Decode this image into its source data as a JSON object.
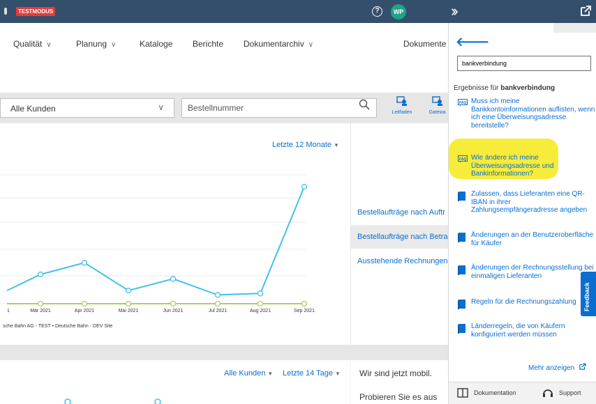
{
  "topbar": {
    "badge": "TESTMODUS",
    "help": "?",
    "avatar": "WP"
  },
  "nav": {
    "items": [
      "Qualität",
      "Planung",
      "Kataloge",
      "Berichte",
      "Dokumentarchiv"
    ],
    "docs": "Dokumente"
  },
  "filters": {
    "customer": "Alle Kunden",
    "order_placeholder": "Bestellnummer",
    "tools": [
      "Leitfaden",
      "Gatewa"
    ]
  },
  "chart": {
    "range": "Letzte 12 Monate",
    "legend": "sche Bahn AG - TEST  •  Deutsche Bahn - DEV Site"
  },
  "chart_data": {
    "type": "line",
    "categories": [
      "1",
      "Mär 2021",
      "Apr 2021",
      "Mai 2021",
      "Jun 2021",
      "Jul 2021",
      "Aug 2021",
      "Sep 2021"
    ],
    "series": [
      {
        "name": "sche Bahn AG - TEST",
        "values": [
          0.9,
          2.0,
          2.8,
          0.9,
          1.7,
          0.6,
          0.7,
          8.0
        ],
        "color": "#3fc1e8"
      },
      {
        "name": "Deutsche Bahn - DEV Site",
        "values": [
          0,
          0,
          0,
          0,
          0,
          0,
          0,
          0
        ],
        "color": "#a6d15e"
      }
    ],
    "ylim": [
      0,
      9
    ]
  },
  "side_links": [
    "Bestellaufträge nach Auftr",
    "Bestellaufträge nach Betra",
    "Ausstehende Rechnungen"
  ],
  "lower": {
    "customers": "Alle Kunden",
    "range": "Letzte 14 Tage",
    "mobile_title": "Wir sind jetzt mobil.",
    "mobile_sub": "Probieren Sie es aus"
  },
  "panel": {
    "search_value": "bankverbindung",
    "results_prefix": "Ergebnisse für",
    "results_term": "bankverbindung",
    "results": [
      {
        "type": "faq",
        "text": "Muss ich meine Bankkontoinformationen auflisten, wenn ich eine Überweisungsadresse bereitstelle?"
      },
      {
        "type": "faq",
        "text": "Wie ändere ich meine Überweisungsadresse und Bankinformationen?"
      },
      {
        "type": "doc",
        "text": "Zulassen, dass Lieferanten eine QR-IBAN in ihrer Zahlungsempfängeradresse angeben"
      },
      {
        "type": "doc",
        "text": "Änderungen an der Benutzeroberfläche für Käufer"
      },
      {
        "type": "doc",
        "text": "Änderungen der Rechnungsstellung bei einmaligen Lieferanten"
      },
      {
        "type": "doc",
        "text": "Regeln für die Rechnungszahlung"
      },
      {
        "type": "doc",
        "text": "Länderregeln, die von Käufern konfiguriert werden müssen"
      }
    ],
    "more": "Mehr anzeigen",
    "footer_docs": "Dokumentation",
    "footer_support": "Support",
    "feedback": "Feedback"
  }
}
